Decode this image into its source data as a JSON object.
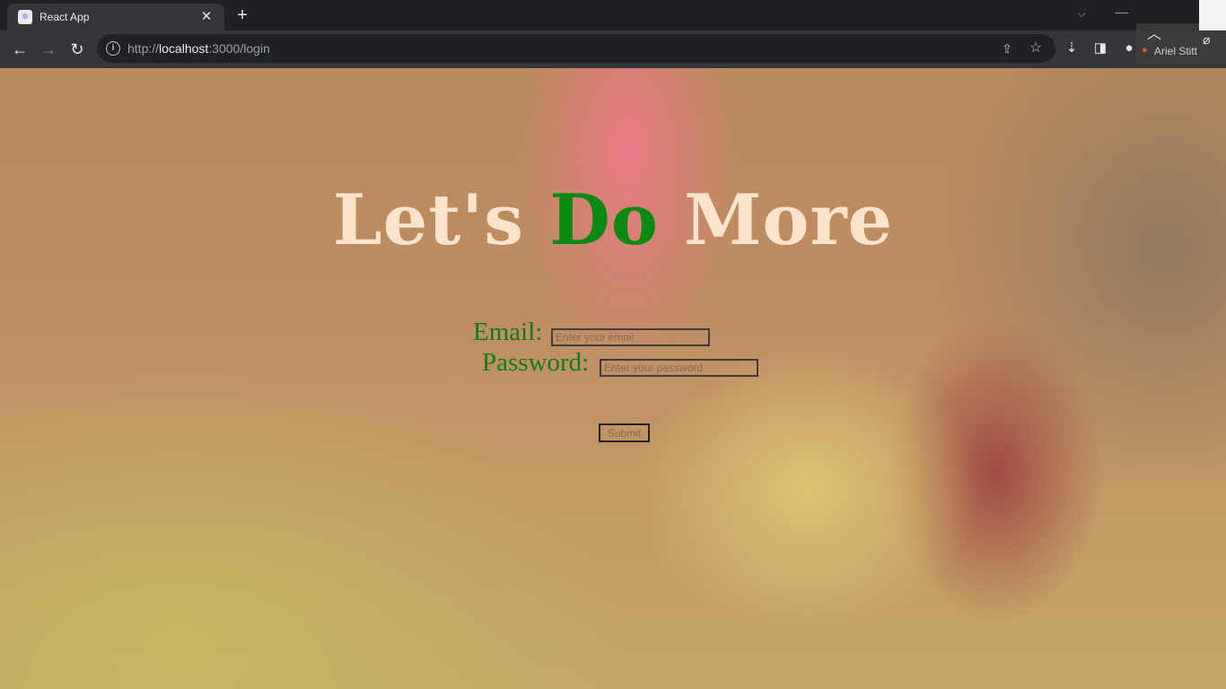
{
  "browser": {
    "tab": {
      "title": "React App",
      "favicon": "react-app-favicon"
    },
    "url": {
      "scheme": "http://",
      "host": "localhost",
      "rest": ":3000/login"
    }
  },
  "meeting_overlay": {
    "participant_name": "Ariel Stitt"
  },
  "page": {
    "headline": {
      "part1": "Let's ",
      "accent": "Do",
      "part2": " More"
    },
    "form": {
      "email_label": "Email:",
      "email_placeholder": "Enter your email",
      "password_label": "Password:",
      "password_placeholder": "Enter your password",
      "submit_label": "Submit"
    }
  },
  "colors": {
    "headline": "#fbe3cd",
    "accent_green": "#0a8a12",
    "label_green": "#0f7d10",
    "chrome_dark": "#202124",
    "chrome_toolbar": "#35363a"
  }
}
